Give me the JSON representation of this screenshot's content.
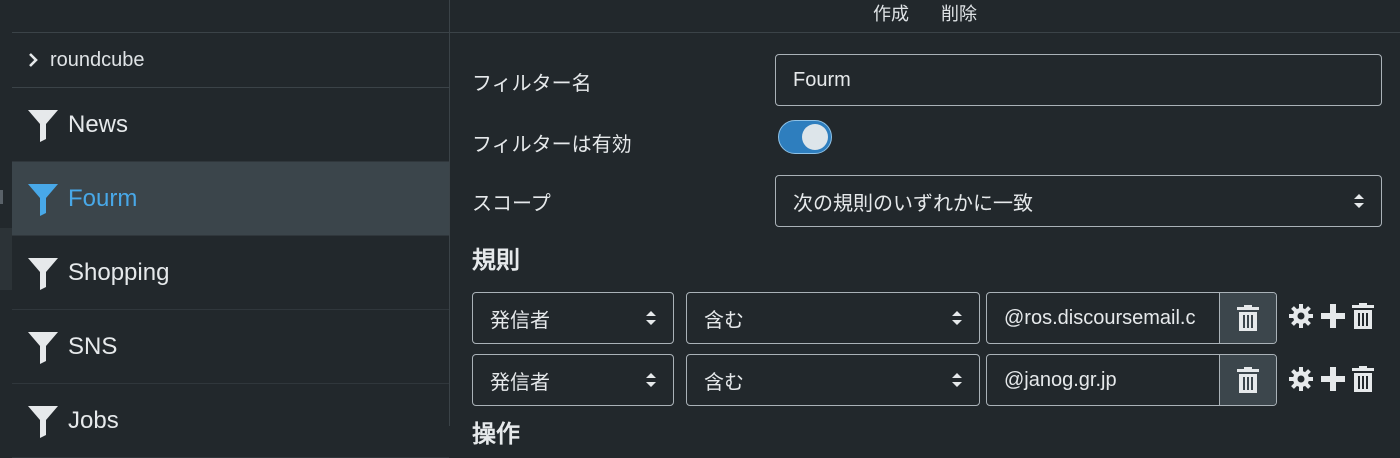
{
  "toolbar": {
    "create_label": "作成",
    "delete_label": "削除"
  },
  "sidebar": {
    "account_label": "roundcube",
    "items": [
      {
        "label": "News"
      },
      {
        "label": "Fourm",
        "selected": true
      },
      {
        "label": "Shopping"
      },
      {
        "label": "SNS"
      },
      {
        "label": "Jobs"
      }
    ]
  },
  "form": {
    "name_label": "フィルター名",
    "name_value": "Fourm",
    "enabled_label": "フィルターは有効",
    "enabled": true,
    "scope_label": "スコープ",
    "scope_value": "次の規則のいずれかに一致",
    "rules_heading": "規則",
    "actions_heading": "操作",
    "rules": [
      {
        "header": "発信者",
        "op": "含む",
        "value": "@ros.discoursemail.c"
      },
      {
        "header": "発信者",
        "op": "含む",
        "value": "@janog.gr.jp"
      }
    ]
  },
  "colors": {
    "background": "#22282c",
    "accent": "#48a8e8",
    "toggle_on": "#2e7ebe",
    "selected_row": "#3b454b"
  }
}
